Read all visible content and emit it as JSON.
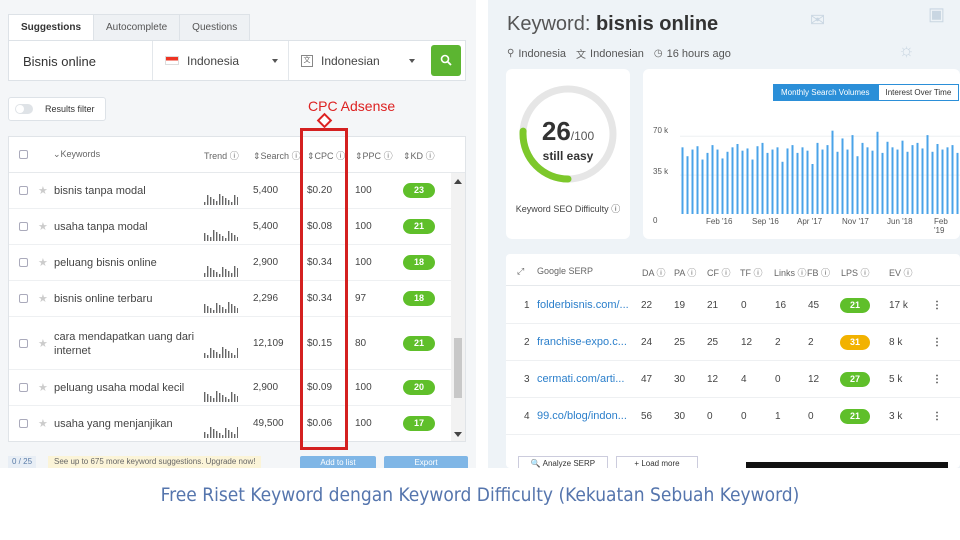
{
  "left": {
    "tabs": [
      "Suggestions",
      "Autocomplete",
      "Questions"
    ],
    "search": {
      "keyword": "Bisnis online",
      "country": "Indonesia",
      "language": "Indonesian"
    },
    "filter_label": "Results filter",
    "annotation": "CPC Adsense",
    "columns": [
      "Keywords",
      "Trend",
      "Search",
      "CPC",
      "PPC",
      "KD"
    ],
    "rows": [
      {
        "keyword": "bisnis tanpa modal",
        "search": "5,400",
        "cpc": "$0.20",
        "ppc": "100",
        "kd": "23"
      },
      {
        "keyword": "usaha tanpa modal",
        "search": "5,400",
        "cpc": "$0.08",
        "ppc": "100",
        "kd": "21"
      },
      {
        "keyword": "peluang bisnis online",
        "search": "2,900",
        "cpc": "$0.34",
        "ppc": "100",
        "kd": "18"
      },
      {
        "keyword": "bisnis online terbaru",
        "search": "2,296",
        "cpc": "$0.34",
        "ppc": "97",
        "kd": "18"
      },
      {
        "keyword": "cara mendapatkan uang dari internet",
        "search": "12,109",
        "cpc": "$0.15",
        "ppc": "80",
        "kd": "21"
      },
      {
        "keyword": "peluang usaha modal kecil",
        "search": "2,900",
        "cpc": "$0.09",
        "ppc": "100",
        "kd": "20"
      },
      {
        "keyword": "usaha yang menjanjikan",
        "search": "49,500",
        "cpc": "$0.06",
        "ppc": "100",
        "kd": "17"
      }
    ],
    "bottom": {
      "count": "0 / 25",
      "promo": "See up to 675 more keyword suggestions. Upgrade now!",
      "add": "Add to list",
      "export": "Export"
    }
  },
  "right": {
    "title_prefix": "Keyword:",
    "title_keyword": "bisnis online",
    "meta": {
      "country": "Indonesia",
      "language": "Indonesian",
      "time": "16 hours ago"
    },
    "difficulty": {
      "value": "26",
      "max": "/100",
      "label": "still easy",
      "footer": "Keyword SEO Difficulty",
      "fraction": 0.26
    },
    "volume": {
      "toggle_on": "Monthly Search Volumes",
      "toggle_off": "Interest Over Time",
      "y_labels": [
        "70 k",
        "35 k",
        "0"
      ],
      "x_labels": [
        "Feb '16",
        "Sep '16",
        "Apr '17",
        "Nov '17",
        "Jun '18",
        "Feb '19"
      ]
    },
    "serp": {
      "header": [
        "Google SERP",
        "DA",
        "PA",
        "CF",
        "TF",
        "Links",
        "FB",
        "LPS",
        "EV"
      ],
      "rows": [
        {
          "n": "1",
          "url": "folderbisnis.com/...",
          "da": "22",
          "pa": "19",
          "cf": "21",
          "tf": "0",
          "links": "16",
          "fb": "45",
          "lps": "21",
          "ev": "17 k",
          "color": "#5fbf2a"
        },
        {
          "n": "2",
          "url": "franchise-expo.c...",
          "da": "24",
          "pa": "25",
          "cf": "25",
          "tf": "12",
          "links": "2",
          "fb": "2",
          "lps": "31",
          "ev": "8 k",
          "color": "#f2b200"
        },
        {
          "n": "3",
          "url": "cermati.com/arti...",
          "da": "47",
          "pa": "30",
          "cf": "12",
          "tf": "4",
          "links": "0",
          "fb": "12",
          "lps": "27",
          "ev": "5 k",
          "color": "#5fbf2a"
        },
        {
          "n": "4",
          "url": "99.co/blog/indon...",
          "da": "56",
          "pa": "30",
          "cf": "0",
          "tf": "0",
          "links": "1",
          "fb": "0",
          "lps": "21",
          "ev": "3 k",
          "color": "#5fbf2a"
        }
      ],
      "analyze": "Analyze SERP",
      "loadmore": "Load more"
    }
  },
  "chart_data": {
    "type": "bar",
    "ylim": [
      0,
      90000
    ],
    "y_ticks": [
      0,
      35000,
      70000
    ],
    "x_tick_labels": [
      "Feb '16",
      "Sep '16",
      "Apr '17",
      "Nov '17",
      "Jun '18",
      "Feb '19"
    ],
    "values": [
      60000,
      52000,
      58000,
      61000,
      49000,
      55000,
      62000,
      58000,
      50000,
      56000,
      60000,
      63000,
      57000,
      59000,
      49000,
      61000,
      64000,
      55000,
      58000,
      60000,
      47000,
      59000,
      62000,
      55000,
      60000,
      57000,
      45000,
      64000,
      58000,
      62000,
      75000,
      56000,
      68000,
      58000,
      71000,
      52000,
      64000,
      60000,
      57000,
      74000,
      55000,
      65000,
      60000,
      58000,
      66000,
      56000,
      62000,
      64000,
      59000,
      71000,
      56000,
      63000,
      58000,
      60000,
      62000,
      55000
    ]
  },
  "caption": "Free Riset Keyword dengan Keyword Difficulty (Kekuatan Sebuah Keyword)"
}
